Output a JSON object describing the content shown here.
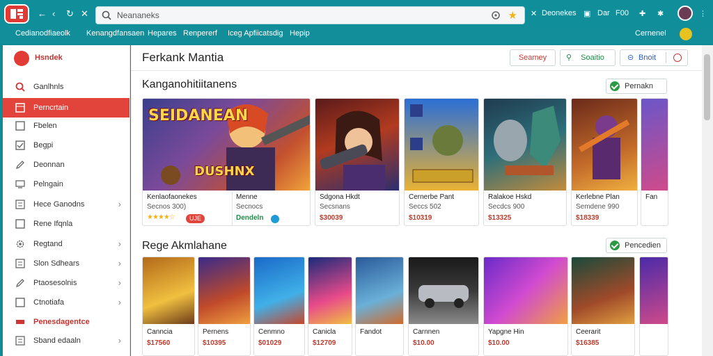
{
  "browser": {
    "url_text": "Neananeks",
    "top_right": {
      "label1": "Deonekes",
      "label2": "Dar",
      "label3": "F00"
    },
    "bookmarks": [
      "Cedianodfiaeolk",
      "Kenangdfansaen",
      "Hepares",
      "Renpererf",
      "Iceg Apfiicatsdig",
      "Hepip"
    ],
    "account_name": "Cernenel"
  },
  "sidebar": {
    "brand": "Hsndek",
    "items": [
      {
        "label": "Ganlhnls",
        "icon": "search-icon"
      },
      {
        "label": "Perncrtain",
        "icon": "grid-icon"
      },
      {
        "label": "Fbelen",
        "icon": "square-icon"
      },
      {
        "label": "Begpi",
        "icon": "checkbox-icon"
      },
      {
        "label": "Deonnan",
        "icon": "pencil-icon"
      },
      {
        "label": "Pelngain",
        "icon": "monitor-icon"
      },
      {
        "label": "Hece Ganodns",
        "icon": "list-icon"
      },
      {
        "label": "Rene Ifqnla",
        "icon": "square-icon"
      },
      {
        "label": "Regtand",
        "icon": "gear-icon"
      },
      {
        "label": "Slon Sdhears",
        "icon": "list-icon"
      },
      {
        "label": "Ptaosesolnis",
        "icon": "pencil-icon"
      },
      {
        "label": "Ctnotiafa",
        "icon": "square-icon"
      },
      {
        "label": "Penesdagentce",
        "icon": "minus-icon"
      },
      {
        "label": "Sband edaaln",
        "icon": "list-icon"
      }
    ]
  },
  "main": {
    "title": "Ferkank Mantia",
    "buttons": {
      "save": "Seamey",
      "studio": "Soaitio",
      "share": "Bnoit"
    },
    "sections": [
      {
        "title": "Kanganohitiitanens",
        "action": "Pernakn",
        "cards": [
          {
            "art_text": "SEIDANEAN",
            "art_sub": "DUSHNX",
            "name": "Kenlaofaonekes",
            "sub": "Secnos 300)",
            "badge": "UJE"
          },
          {
            "name": "Menne",
            "sub": "Secnocs",
            "link": "Dendeln"
          },
          {
            "name": "Sdgona Hkdt",
            "sub": "Secsnans",
            "price": "$30039"
          },
          {
            "name": "Cernerbe Pant",
            "sub": "Seccs 502",
            "price": "$10319"
          },
          {
            "name": "Ralakoe Hskd",
            "sub": "Secdcs 900",
            "price": "$13325"
          },
          {
            "name": "Kerlebne Plan",
            "sub": "Semdene 990",
            "price": "$18339"
          },
          {
            "name": "Fan"
          }
        ]
      },
      {
        "title": "Rege Akmlahane",
        "action": "Pencedien",
        "cards": [
          {
            "name": "Canncia",
            "price": "$17560"
          },
          {
            "name": "Pernens",
            "price": "$10395"
          },
          {
            "name": "Cenmno",
            "price": "$01029"
          },
          {
            "name": "Canicla",
            "price": "$12709"
          },
          {
            "name": "Fandot"
          },
          {
            "name": "Carnnen",
            "price": "$10.00"
          },
          {
            "name": "Yapgne Hin",
            "price": "$10.00"
          },
          {
            "name": "Ceerarit",
            "price": "$16385"
          }
        ]
      }
    ]
  },
  "colors": {
    "teal": "#108f9b",
    "accent_red": "#e2433b",
    "price_red": "#c0392b",
    "green": "#238a49"
  }
}
